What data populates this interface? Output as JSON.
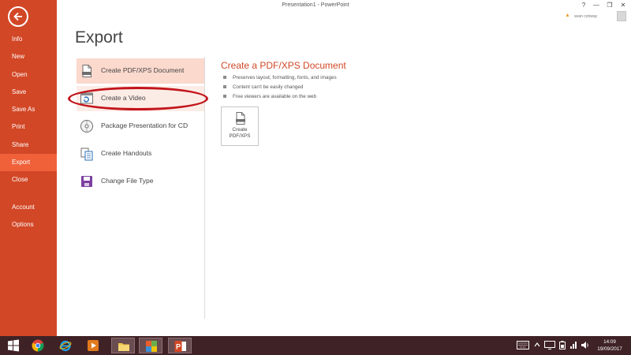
{
  "window": {
    "title": "Presentation1 - PowerPoint",
    "help": "?",
    "minimize": "—",
    "restore": "❐",
    "close": "✕"
  },
  "user": {
    "name": "sean conway"
  },
  "nav": {
    "back": "back-arrow-icon",
    "items": [
      {
        "label": "Info"
      },
      {
        "label": "New"
      },
      {
        "label": "Open"
      },
      {
        "label": "Save"
      },
      {
        "label": "Save As"
      },
      {
        "label": "Print"
      },
      {
        "label": "Share"
      },
      {
        "label": "Export",
        "active": true
      },
      {
        "label": "Close"
      },
      {
        "label": "Account"
      },
      {
        "label": "Options"
      }
    ]
  },
  "page": {
    "title": "Export"
  },
  "options": [
    {
      "label": "Create PDF/XPS Document",
      "icon": "pdf-document-icon",
      "selected": true
    },
    {
      "label": "Create a Video",
      "icon": "video-icon",
      "highlighted": true
    },
    {
      "label": "Package Presentation for CD",
      "icon": "cd-icon"
    },
    {
      "label": "Create Handouts",
      "icon": "handouts-icon"
    },
    {
      "label": "Change File Type",
      "icon": "file-type-icon"
    }
  ],
  "detail": {
    "title": "Create a PDF/XPS Document",
    "bullets": [
      "Preserves layout, formatting, fonts, and images",
      "Content can't be easily changed",
      "Free viewers are available on the web"
    ],
    "button": {
      "line1": "Create",
      "line2": "PDF/XPS",
      "icon": "pdf-document-icon"
    }
  },
  "taskbar": {
    "apps": [
      "windows-start-icon",
      "chrome-icon",
      "internet-explorer-icon",
      "media-player-icon",
      "file-explorer-icon",
      "app-icon",
      "powerpoint-icon"
    ],
    "time": "14:09",
    "date": "19/09/2017"
  },
  "colors": {
    "accent": "#d24726",
    "nav_active": "#f0613a",
    "selected": "#fbd9cd",
    "highlight_ring": "#c3141b",
    "taskbar": "#3f2226"
  }
}
